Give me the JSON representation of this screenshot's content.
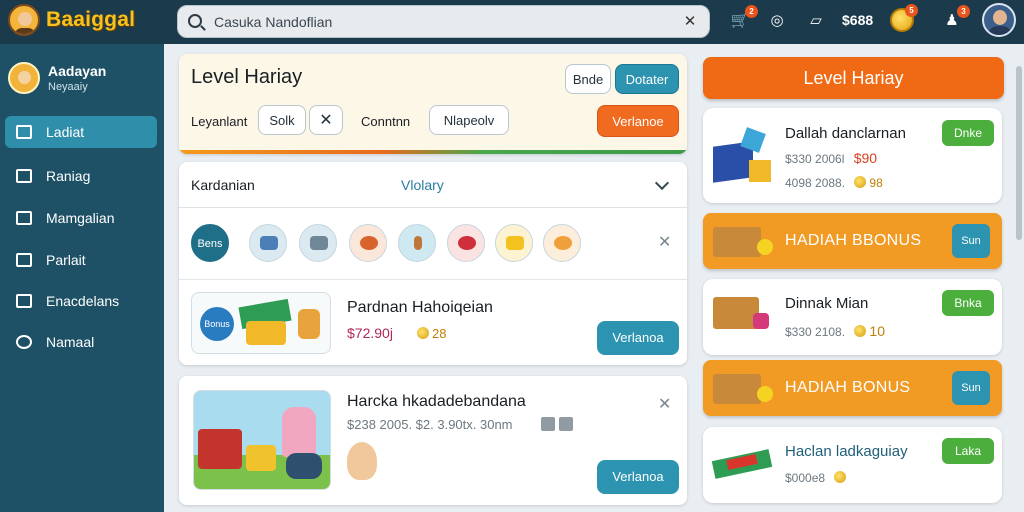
{
  "header": {
    "brand": "Baaiggal",
    "search": {
      "placeholder": "Casuka Nandoflian",
      "value": ""
    },
    "badges": {
      "cart": "2",
      "coins": "5",
      "notifications": "3"
    },
    "stat_text": "$688",
    "icons": [
      "search-icon",
      "close-icon",
      "cart-icon",
      "target-icon",
      "bookmark-icon",
      "coin-icon",
      "notification-icon",
      "avatar"
    ]
  },
  "sidebar": {
    "profile": {
      "name": "Aadayan",
      "subtitle": "Neyaaiy"
    },
    "items": [
      {
        "label": "Ladiat",
        "icon": "grid-icon",
        "active": true
      },
      {
        "label": "Raniag",
        "icon": "list-icon",
        "active": false
      },
      {
        "label": "Mamgalian",
        "icon": "home-icon",
        "active": false
      },
      {
        "label": "Parlait",
        "icon": "screen-icon",
        "active": false
      },
      {
        "label": "Enacdelans",
        "icon": "bag-icon",
        "active": false
      },
      {
        "label": "Namaal",
        "icon": "settings-icon",
        "active": false
      }
    ]
  },
  "level_card": {
    "title": "Level Hariay",
    "btn_secondary": "Bnde",
    "btn_primary": "Dotater",
    "filter1_label": "Leyanlant",
    "filter1_value": "Solk",
    "filter2_label": "Conntnn",
    "filter2_value": "Nlapeolv",
    "cta": "Verlanoe"
  },
  "category_card": {
    "label": "Kardanian",
    "value": "Vlolary",
    "selected_chip": "Bens",
    "chips": [
      "tool-icon",
      "bag-icon",
      "fruit-icon",
      "stick-icon",
      "badge-icon",
      "star-icon",
      "pet-icon"
    ],
    "product": {
      "title": "Pardnan Hahoiqeian",
      "price": "$72.90j",
      "coins": "28",
      "action": "Verlanoa",
      "badge": "Bonus"
    }
  },
  "reward_card": {
    "title": "Harcka hkadadebandana",
    "meta": "$238 2005. $2. 3.90tx. 30nm",
    "action": "Verlanoa"
  },
  "right_panel": {
    "title": "Level Hariay",
    "deals": [
      {
        "title": "Dallah danclarnan",
        "meta1": "$330 2006l",
        "price": "$90",
        "meta2": "4098 2088.",
        "coins": "98",
        "action": "Dnke"
      },
      {
        "title": "Dinnak Mian",
        "meta1": "$330 2108.",
        "coins": "10",
        "action": "Bnka"
      },
      {
        "title": "Haclan ladkaguiay",
        "meta1": "$000e8",
        "action": "Laka"
      }
    ],
    "bonuses": [
      {
        "text": "HADIAH BBONUS",
        "action": "Sun"
      },
      {
        "text": "HADIAH BONUS",
        "action": "Sun"
      }
    ]
  },
  "colors": {
    "topbar": "#1b3a4b",
    "sidebar": "#1e5166",
    "accent_teal": "#2c93b0",
    "accent_orange": "#f06a1f",
    "accent_green": "#4caf3d",
    "bonus": "#f19a24"
  }
}
